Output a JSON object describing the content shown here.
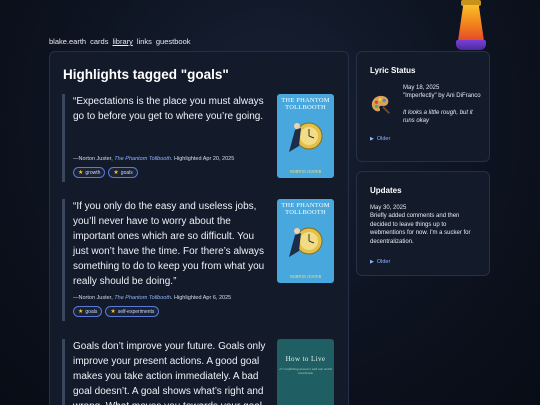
{
  "nav": {
    "items": [
      {
        "label": "blake.earth"
      },
      {
        "label": "cards"
      },
      {
        "label": "library"
      },
      {
        "label": "links"
      },
      {
        "label": "guestbook"
      }
    ]
  },
  "main": {
    "title": "Highlights tagged \"goals\"",
    "highlights": [
      {
        "quote": "“Expectations is the place you must always go to before you get to where you’re going.",
        "author": "—Norton Juster, ",
        "book": "The Phantom Tollbooth",
        "highlighted": ". Highlighted Apr 20, 2025",
        "tags": [
          "growth",
          "goals"
        ]
      },
      {
        "quote": "“If you only do the easy and useless jobs, you’ll never have to worry about the important ones which are so difficult. You just won’t have the time. For there’s always something to do to keep you from what you really should be doing.”",
        "author": "—Norton Juster, ",
        "book": "The Phantom Tollbooth",
        "highlighted": ". Highlighted Apr 6, 2025",
        "tags": [
          "goals",
          "self-experiments"
        ]
      },
      {
        "quote": "Goals don’t improve your future. Goals only improve your present actions. A good goal makes you take action immediately. A bad goal doesn’t. A goal shows what’s right and wrong. What moves you towards your goal"
      }
    ],
    "covers": [
      {
        "title_line1": "THE PHANTOM",
        "title_line2": "TOLLBOOTH",
        "author": "NORTON JUSTER"
      },
      {
        "title_line1": "THE PHANTOM",
        "title_line2": "TOLLBOOTH",
        "author": "NORTON JUSTER"
      },
      {
        "title": "How to Live",
        "subtitle": "27 conflicting answers and one weird conclusion"
      }
    ]
  },
  "lyric_status": {
    "heading": "Lyric Status",
    "date": "May 18, 2025",
    "song": "\"Imperfectly\" by Ani DiFranco",
    "lyric": "It looks a little rough, but it runs okay",
    "older": "Older"
  },
  "updates": {
    "heading": "Updates",
    "date": "May 30, 2025",
    "body": "Briefly added comments and then decided to leave things up to webmentions for now. I'm a sucker for decentralization.",
    "older": "Older"
  },
  "colors": {
    "background": "#0d1320",
    "card": "#131b2b",
    "link_accent": "#8fb3ff",
    "tag_border": "#5a7ad6",
    "star": "#f5c518"
  },
  "icons": [
    "lava-lamp-icon",
    "star-icon",
    "palette-icon",
    "triangle-right-icon"
  ]
}
